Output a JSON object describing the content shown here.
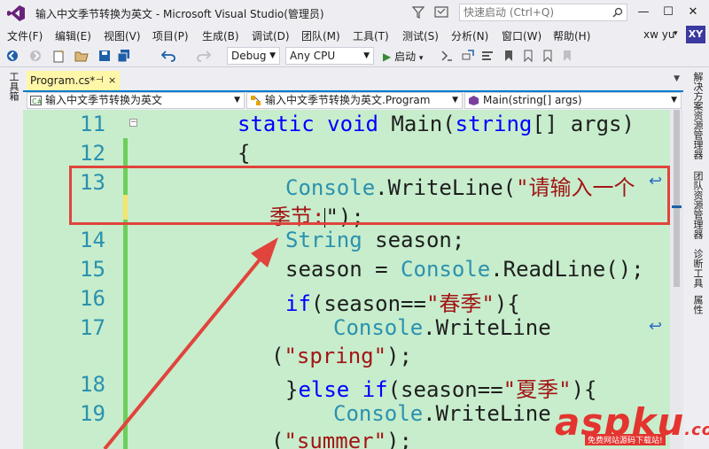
{
  "window": {
    "title": "输入中文季节转换为英文 - Microsoft Visual Studio(管理员)",
    "quick_launch_placeholder": "快速启动 (Ctrl+Q)"
  },
  "menu": [
    "文件(F)",
    "编辑(E)",
    "视图(V)",
    "项目(P)",
    "生成(B)",
    "调试(D)",
    "团队(M)",
    "工具(T)",
    "测试(S)",
    "分析(N)",
    "窗口(W)",
    "帮助(H)"
  ],
  "account": {
    "user": "xw yu",
    "avatar": "XY"
  },
  "toolbar": {
    "config": "Debug",
    "platform": "Any CPU",
    "start": "启动"
  },
  "left_strip": {
    "toolbox": "工具箱"
  },
  "right_strip": {
    "solution_explorer": "解决方案资源管理器",
    "team_explorer": "团队资源管理器",
    "diagnostics": "诊断工具",
    "properties": "属性"
  },
  "tab": {
    "label": "Program.cs*",
    "pin": "⊣",
    "close": "×"
  },
  "navbar": {
    "project": "输入中文季节转换为英文",
    "class": "输入中文季节转换为英文.Program",
    "member": "Main(string[] args)"
  },
  "editor": {
    "line_numbers": [
      "11",
      "12",
      "13",
      "14",
      "15",
      "16",
      "17",
      "18",
      "19"
    ],
    "lines": {
      "l11a": "static",
      "l11b": "void",
      "l11c": "Main(",
      "l11d": "string",
      "l11e": "[] args)",
      "l12": "{",
      "l13a": "Console",
      "l13b": ".WriteLine(",
      "l13c": "\"请输入一个",
      "l13w1": "季节:",
      "l13w2": "\");",
      "l14a": "String",
      "l14b": " season;",
      "l15a": "season = ",
      "l15b": "Console",
      "l15c": ".ReadLine();",
      "l16a": "if",
      "l16b": "(season==",
      "l16c": "\"春季\"",
      "l16d": "){",
      "l17a": "Console",
      "l17b": ".WriteLine",
      "l17w1": "(",
      "l17w2": "\"spring\"",
      "l17w3": ");",
      "l18a": "}",
      "l18b": "else",
      "l18c": " ",
      "l18d": "if",
      "l18e": "(season==",
      "l18f": "\"夏季\"",
      "l18g": "){",
      "l19a": "Console",
      "l19b": ".WriteLine",
      "l19w1": "(",
      "l19w2": "\"summer\"",
      "l19w3": ");"
    }
  },
  "watermark": {
    "logo": "aspku",
    "tld": ".com",
    "sub": "免费网站源码下载站!"
  },
  "colors": {
    "editor_bg": "#c7edcc",
    "keyword": "#0000ff",
    "type": "#2b91af",
    "string": "#a31515",
    "highlight": "#e0443c",
    "tab": "#fff6a8",
    "accent": "#007acc"
  }
}
